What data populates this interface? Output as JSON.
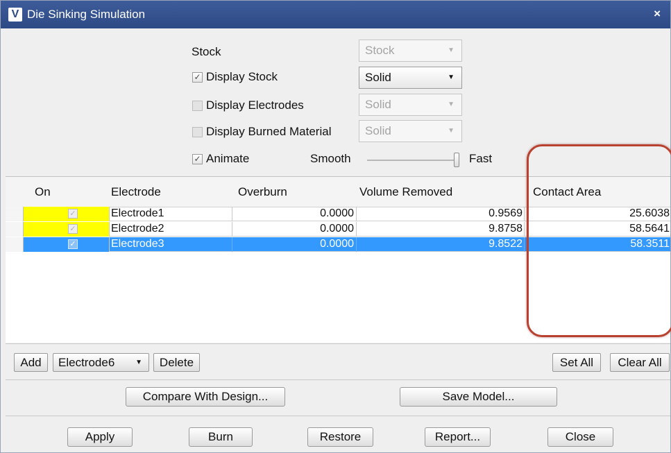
{
  "window": {
    "title": "Die Sinking Simulation",
    "app_icon": "V",
    "close_glyph": "×"
  },
  "display": {
    "stock_label": "Stock",
    "stock_select": "Stock",
    "display_stock": {
      "label": "Display Stock",
      "checked": true,
      "mode": "Solid"
    },
    "display_electrodes": {
      "label": "Display Electrodes",
      "checked": false,
      "mode": "Solid"
    },
    "display_burned": {
      "label": "Display Burned Material",
      "checked": false,
      "mode": "Solid"
    },
    "animate": {
      "label": "Animate",
      "checked": true
    },
    "speed": {
      "min_label": "Smooth",
      "max_label": "Fast",
      "level": 1.0
    }
  },
  "table": {
    "headers": {
      "on": "On",
      "electrode": "Electrode",
      "overburn": "Overburn",
      "volume": "Volume Removed",
      "contact": "Contact Area"
    },
    "rows": [
      {
        "on": true,
        "electrode": "Electrode1",
        "overburn": "0.0000",
        "volume": "0.9569",
        "contact": "25.6038",
        "selected": false
      },
      {
        "on": true,
        "electrode": "Electrode2",
        "overburn": "0.0000",
        "volume": "9.8758",
        "contact": "58.5641",
        "selected": false
      },
      {
        "on": true,
        "electrode": "Electrode3",
        "overburn": "0.0000",
        "volume": "9.8522",
        "contact": "58.3511",
        "selected": true
      }
    ]
  },
  "electrode_bar": {
    "add": "Add",
    "electrode_select": "Electrode6",
    "delete": "Delete",
    "set_all": "Set All",
    "clear_all": "Clear All"
  },
  "actions": {
    "compare": "Compare With Design...",
    "save_model": "Save Model..."
  },
  "footer": {
    "apply": "Apply",
    "burn": "Burn",
    "restore": "Restore",
    "report": "Report...",
    "close": "Close"
  },
  "icons": {
    "checkbox_checked": "✓",
    "dropdown_arrow": "▼"
  },
  "colors": {
    "title_bar": "#2d4a85",
    "selected_row": "#3399ff",
    "on_cell": "#ffff00",
    "annotation": "#b8422f"
  }
}
